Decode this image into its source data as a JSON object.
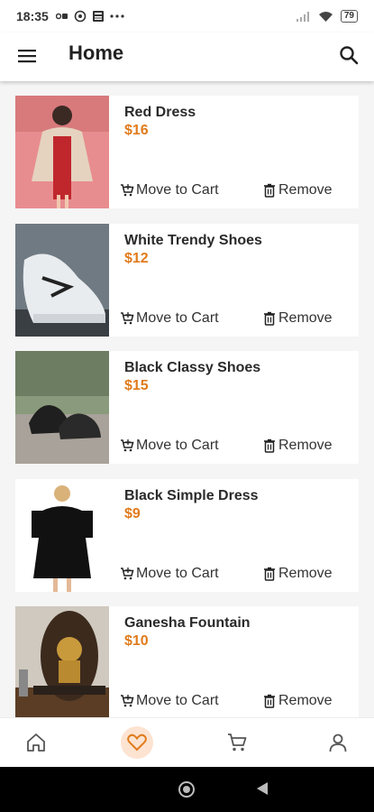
{
  "status": {
    "time": "18:35",
    "battery": "79",
    "icons_left": [
      "sim-icon",
      "whatsapp-icon",
      "news-icon",
      "more-dots-icon"
    ],
    "icons_right": [
      "signal-icon",
      "wifi-icon",
      "battery-icon"
    ]
  },
  "app_bar": {
    "title": "Home",
    "menu_icon": "hamburger-menu-icon",
    "search_icon": "search-icon"
  },
  "colors": {
    "price": "#e07b1c",
    "active_nav_bg": "#fde3d1",
    "card_bg": "#ffffff",
    "page_bg": "#f5f5f5"
  },
  "items": [
    {
      "name": "Red Dress",
      "price": "$16",
      "move_label": "Move to Cart",
      "remove_label": "Remove"
    },
    {
      "name": "White Trendy Shoes",
      "price": "$12",
      "move_label": "Move to Cart",
      "remove_label": "Remove"
    },
    {
      "name": "Black Classy Shoes",
      "price": "$15",
      "move_label": "Move to Cart",
      "remove_label": "Remove"
    },
    {
      "name": "Black Simple Dress",
      "price": "$9",
      "move_label": "Move to Cart",
      "remove_label": "Remove"
    },
    {
      "name": "Ganesha Fountain",
      "price": "$10",
      "move_label": "Move to Cart",
      "remove_label": "Remove"
    }
  ],
  "bottom_nav": [
    {
      "icon": "home-icon",
      "active": false
    },
    {
      "icon": "heart-icon",
      "active": true
    },
    {
      "icon": "cart-icon",
      "active": false
    },
    {
      "icon": "profile-icon",
      "active": false
    }
  ]
}
